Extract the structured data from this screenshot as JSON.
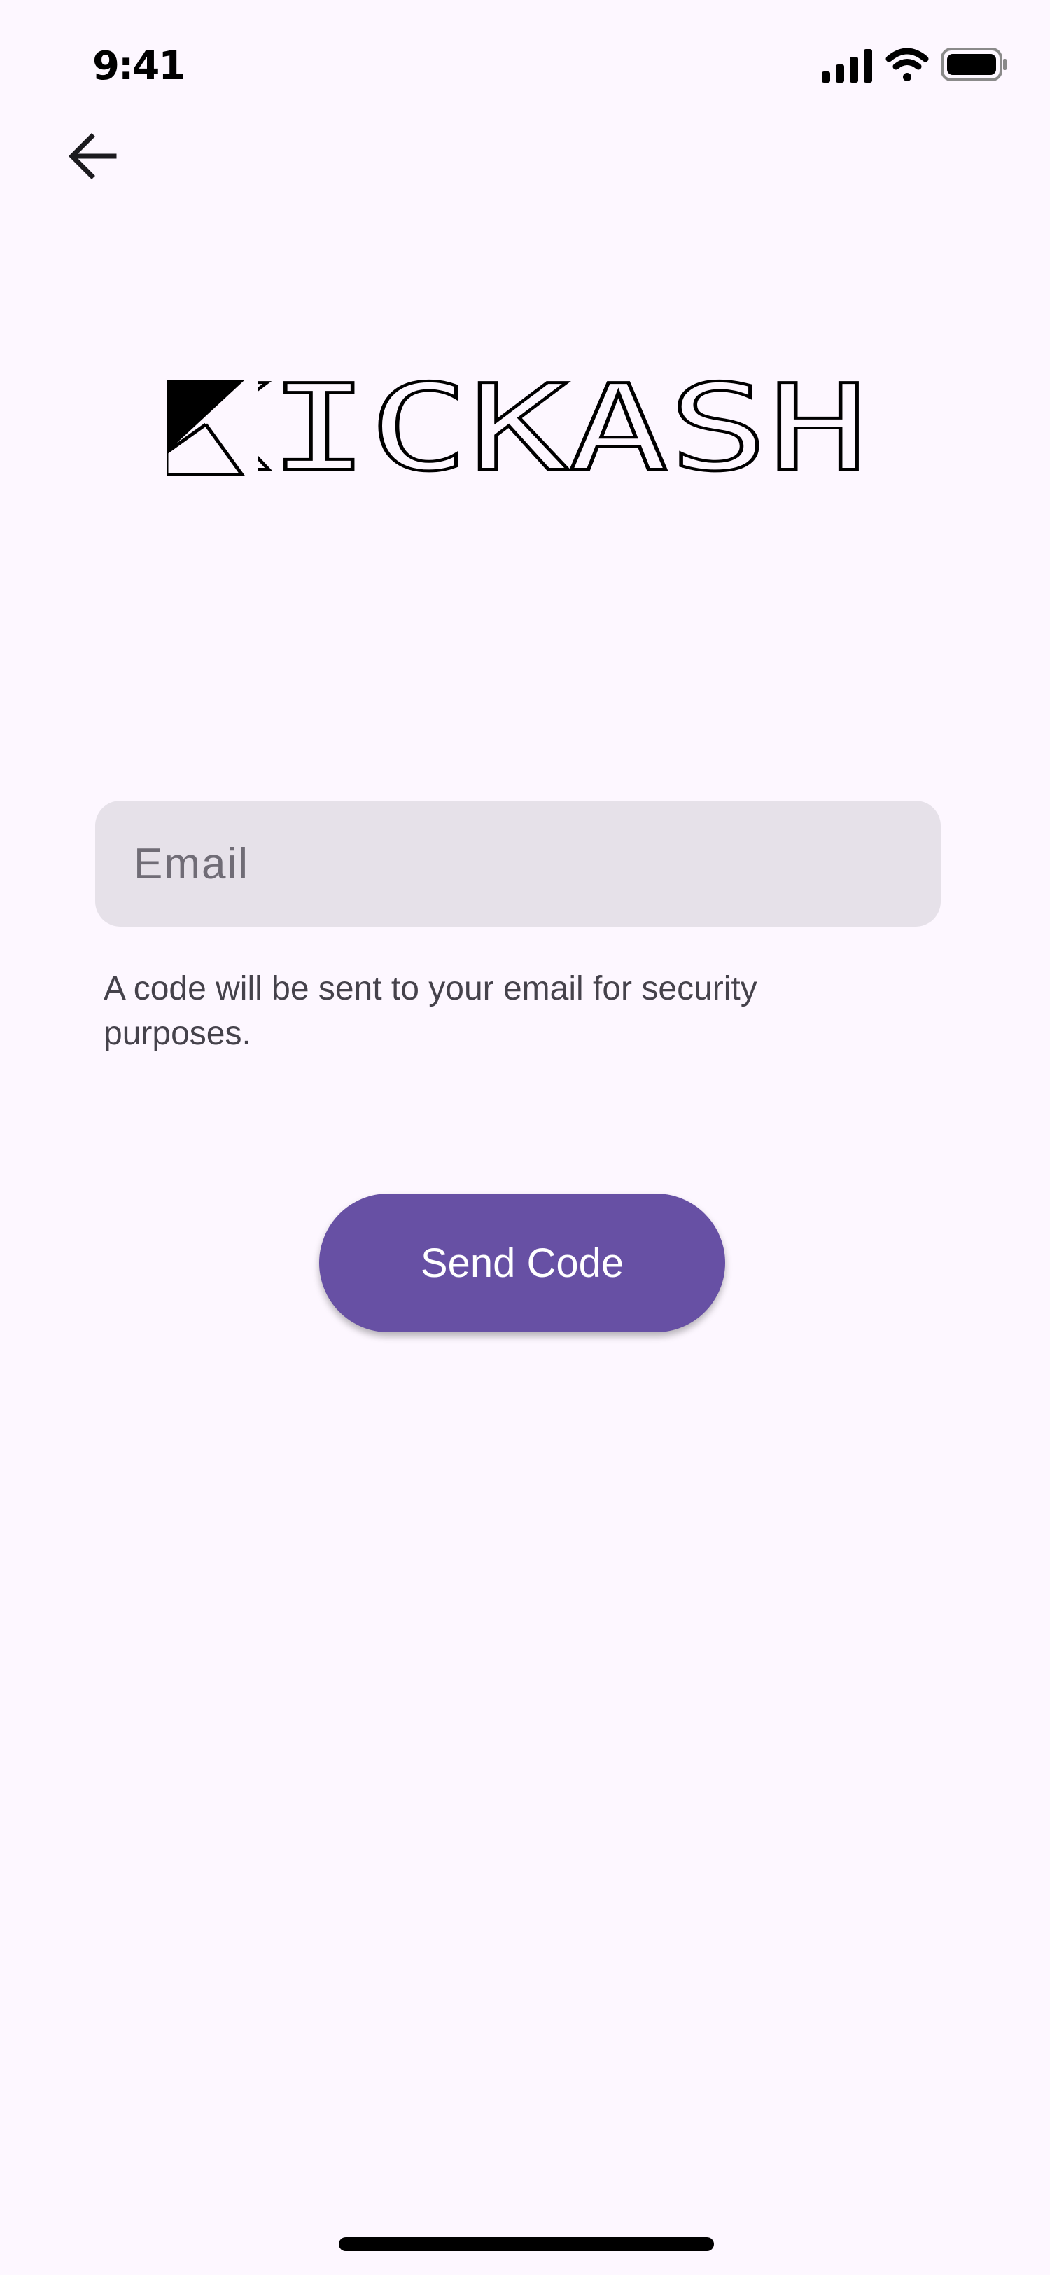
{
  "status_bar": {
    "time": "9:41",
    "icons": [
      "cellular-signal-icon",
      "wifi-icon",
      "battery-icon"
    ]
  },
  "header": {
    "back_icon": "arrow-left-icon"
  },
  "logo": {
    "text": "KICKASH",
    "mark_icon": "kickash-logo-mark"
  },
  "form": {
    "email": {
      "value": "",
      "placeholder": "Email"
    },
    "helper_text": "A code will be sent to your email for security purposes.",
    "submit_label": "Send Code"
  },
  "colors": {
    "background": "#fdf7ff",
    "field_background": "#e6e1e9",
    "primary": "#6750a4",
    "on_primary": "#ffffff",
    "helper_text": "#45424b"
  }
}
